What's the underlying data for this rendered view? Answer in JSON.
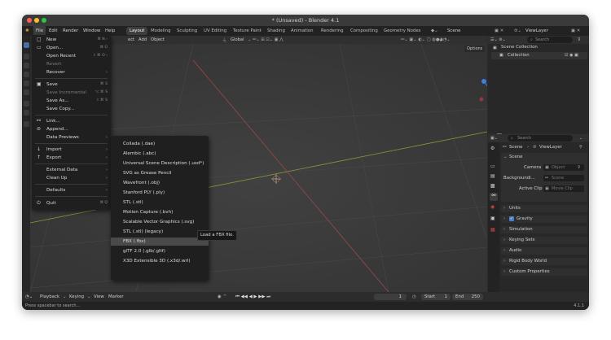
{
  "window": {
    "title": "* (Unsaved) - Blender 4.1"
  },
  "topbar": {
    "menus": [
      "File",
      "Edit",
      "Render",
      "Window",
      "Help"
    ],
    "workspaces": [
      "Layout",
      "Modeling",
      "Sculpting",
      "UV Editing",
      "Texture Paint",
      "Shading",
      "Animation",
      "Rendering",
      "Compositing",
      "Geometry Nodes"
    ],
    "active_workspace": "Layout",
    "scene": "Scene",
    "view_layer": "ViewLayer"
  },
  "viewport_header": {
    "items": [
      "ect",
      "Add",
      "Object"
    ],
    "orientation": "Global",
    "options": "Options"
  },
  "file_menu": {
    "items": [
      {
        "icon": "□",
        "label": "New",
        "shortcut": "⌘ N ›"
      },
      {
        "icon": "▭",
        "label": "Open...",
        "shortcut": "⌘ O"
      },
      {
        "icon": "",
        "label": "Open Recent",
        "shortcut": "⇧ ⌘ O ›"
      },
      {
        "icon": "",
        "label": "Revert",
        "shortcut": "",
        "dim": true
      },
      {
        "icon": "",
        "label": "Recover",
        "shortcut": "›"
      },
      {
        "icon": "▣",
        "label": "Save",
        "shortcut": "⌘ S"
      },
      {
        "icon": "",
        "label": "Save Incremental",
        "shortcut": "⌥ ⌘ S",
        "dim": true
      },
      {
        "icon": "",
        "label": "Save As...",
        "shortcut": "⇧ ⌘ S"
      },
      {
        "icon": "",
        "label": "Save Copy...",
        "shortcut": ""
      },
      {
        "icon": "⚯",
        "label": "Link...",
        "shortcut": ""
      },
      {
        "icon": "⊘",
        "label": "Append...",
        "shortcut": ""
      },
      {
        "icon": "",
        "label": "Data Previews",
        "shortcut": "›"
      },
      {
        "icon": "↓",
        "label": "Import",
        "shortcut": "›"
      },
      {
        "icon": "↑",
        "label": "Export",
        "shortcut": "›"
      },
      {
        "icon": "",
        "label": "External Data",
        "shortcut": "›"
      },
      {
        "icon": "",
        "label": "Clean Up",
        "shortcut": "›"
      },
      {
        "icon": "",
        "label": "Defaults",
        "shortcut": "›"
      },
      {
        "icon": "⏻",
        "label": "Quit",
        "shortcut": "⌘ Q"
      }
    ]
  },
  "export_menu": {
    "items": [
      "Collada (.dae)",
      "Alembic (.abc)",
      "Universal Scene Description (.usd*)",
      "SVG as Grease Pencil",
      "Wavefront (.obj)",
      "Stanford PLY (.ply)",
      "STL (.stl)",
      "Motion Capture (.bvh)",
      "Scalable Vector Graphics (.svg)",
      "STL (.stl) (legacy)",
      "FBX (.fbx)",
      "glTF 2.0 (.glb/.gltf)",
      "X3D Extensible 3D (.x3d/.wrl)"
    ],
    "highlighted": "FBX (.fbx)"
  },
  "tooltip": "Load a FBX file.",
  "outliner": {
    "search_placeholder": "Search",
    "scene_collection": "Scene Collection",
    "collection": "Collection"
  },
  "properties": {
    "search_placeholder": "Search",
    "breadcrumb_scene": "Scene",
    "breadcrumb_layer": "ViewLayer",
    "scene_panel": "Scene",
    "camera_label": "Camera",
    "camera_value": "Object",
    "background_label": "Backgroundi...",
    "background_value": "Scene",
    "active_clip_label": "Active Clip",
    "active_clip_value": "Movie Clip",
    "panels": [
      "Units",
      "Gravity",
      "Simulation",
      "Keying Sets",
      "Audio",
      "Rigid Body World",
      "Custom Properties"
    ]
  },
  "timeline": {
    "playback": "Playback",
    "keying": "Keying",
    "view": "View",
    "marker": "Marker",
    "current_frame": "1",
    "start_label": "Start",
    "start_value": "1",
    "end_label": "End",
    "end_value": "250"
  },
  "status": {
    "hint": "Press spacebar to search...",
    "version": "4.1.1"
  },
  "colors": {
    "accent": "#3a4f73",
    "x_axis": "#e0505a",
    "y_axis": "#7fb33a",
    "z_axis": "#3f7fd9"
  }
}
